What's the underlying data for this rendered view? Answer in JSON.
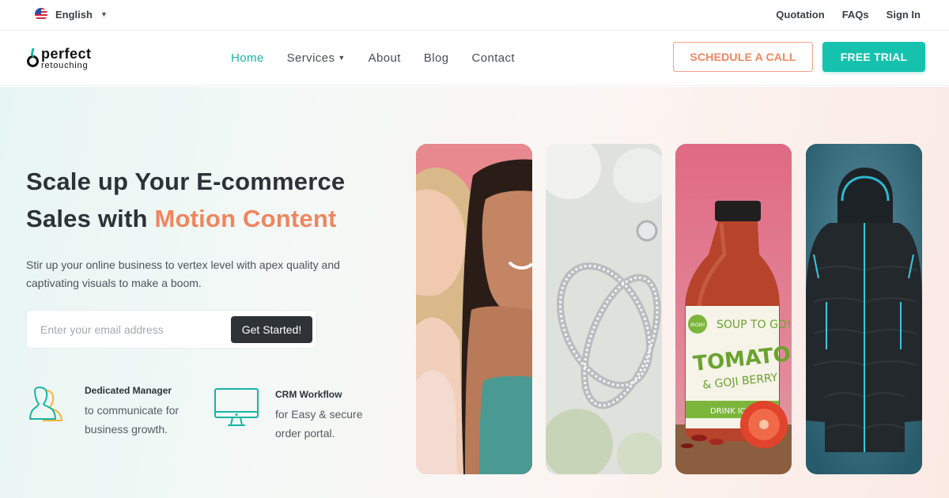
{
  "topbar": {
    "language": "English",
    "links": [
      "Quotation",
      "FAQs",
      "Sign In"
    ]
  },
  "logo": {
    "line1": "perfect",
    "line2": "retouching"
  },
  "nav": {
    "items": [
      "Home",
      "Services",
      "About",
      "Blog",
      "Contact"
    ],
    "active": "Home",
    "schedule_label": "SCHEDULE A CALL",
    "trial_label": "FREE TRIAL"
  },
  "hero": {
    "headline_part1": "Scale up Your E-commerce Sales with ",
    "headline_accent": "Motion Content",
    "subtext": "Stir up your online business to vertex level with apex quality and captivating visuals to make a boom.",
    "email_placeholder": "Enter your email address",
    "cta_label": "Get Started!"
  },
  "features": [
    {
      "title": "Dedicated Manager",
      "desc": "to communicate for business growth."
    },
    {
      "title": "CRM Workflow",
      "desc": "for Easy & secure order portal."
    }
  ],
  "cards": {
    "product_bottle": {
      "brand_line": "SOUP TO GO!",
      "name_line1": "TOMATO",
      "name_line2": "& GOJI BERRY",
      "footer_line": "DRINK ICE-COLD",
      "badge": "IRONY"
    }
  },
  "colors": {
    "accent_teal": "#15c2ae",
    "accent_orange": "#f0855f",
    "dark": "#2d3337"
  }
}
